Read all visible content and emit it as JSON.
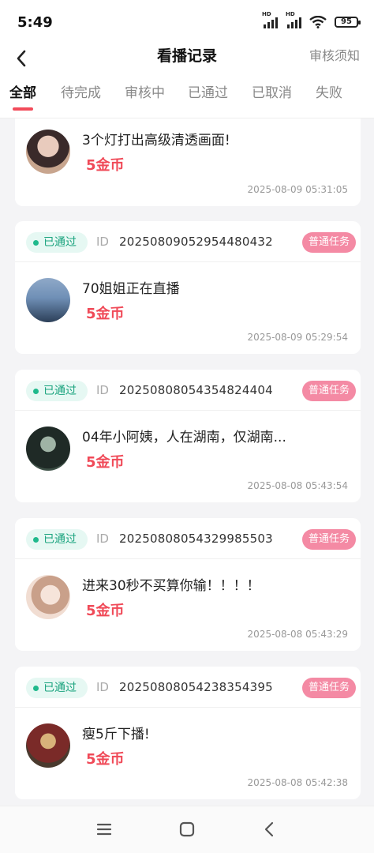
{
  "status_bar": {
    "time": "5:49",
    "battery": "95",
    "network_label": "HD"
  },
  "header": {
    "title": "看播记录",
    "rules_link": "审核须知"
  },
  "tabs": [
    {
      "label": "全部",
      "active": true
    },
    {
      "label": "待完成",
      "active": false
    },
    {
      "label": "审核中",
      "active": false
    },
    {
      "label": "已通过",
      "active": false
    },
    {
      "label": "已取消",
      "active": false
    },
    {
      "label": "失败",
      "active": false
    }
  ],
  "records": [
    {
      "status": "",
      "id_label": "",
      "id": "",
      "task_type": "",
      "title": "3个灯打出高级清透画面!",
      "reward": "5金币",
      "time": "2025-08-09 05:31:05",
      "avatar_colors": [
        "#3a2a2a",
        "#e9cbbd"
      ]
    },
    {
      "status": "已通过",
      "id_label": "ID",
      "id": "20250809052954480432",
      "task_type": "普通任务",
      "title": "70姐姐正在直播",
      "reward": "5金币",
      "time": "2025-08-09 05:29:54",
      "avatar_colors": [
        "#6f8fb6",
        "#2c3f58"
      ]
    },
    {
      "status": "已通过",
      "id_label": "ID",
      "id": "20250808054354824404",
      "task_type": "普通任务",
      "title": "04年小阿姨，人在湖南，仅湖南...",
      "reward": "5金币",
      "time": "2025-08-08 05:43:54",
      "avatar_colors": [
        "#1f2a26",
        "#9fb3a5"
      ]
    },
    {
      "status": "已通过",
      "id_label": "ID",
      "id": "20250808054329985503",
      "task_type": "普通任务",
      "title": "进来30秒不买算你输！！！！",
      "reward": "5金币",
      "time": "2025-08-08 05:43:29",
      "avatar_colors": [
        "#f1ddd2",
        "#c9a08a"
      ]
    },
    {
      "status": "已通过",
      "id_label": "ID",
      "id": "20250808054238354395",
      "task_type": "普通任务",
      "title": "瘦5斤下播!",
      "reward": "5金币",
      "time": "2025-08-08 05:42:38",
      "avatar_colors": [
        "#7a2a28",
        "#d8b27a"
      ]
    }
  ]
}
